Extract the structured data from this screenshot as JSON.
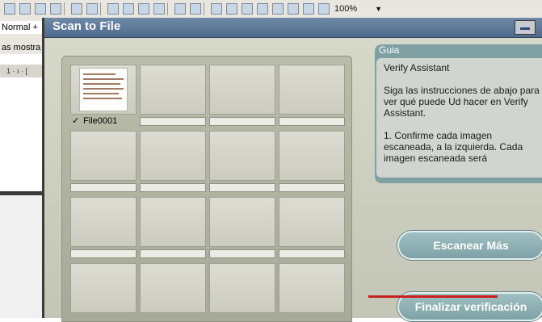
{
  "word": {
    "zoom": "100%",
    "style_box": "Normal +",
    "font_box": "as mostra",
    "ruler": "1 · ı · ["
  },
  "dialog": {
    "title": "Scan to File",
    "files": [
      {
        "name": "File0001",
        "checked": true
      }
    ],
    "guide": {
      "title": "Guia",
      "paragraphs": [
        "Verify Assistant",
        "Siga las instrucciones de abajo para ver qué puede Ud hacer en Verify Assistant.",
        "1. Confirme cada imagen escaneada, a la izquierda. Cada imagen escaneada será"
      ]
    },
    "buttons": {
      "scan_more": "Escanear Más",
      "finish": "Finalizar verificación"
    }
  },
  "icons": {
    "checkbox": "check-icon",
    "minimize": "minimize-icon"
  }
}
